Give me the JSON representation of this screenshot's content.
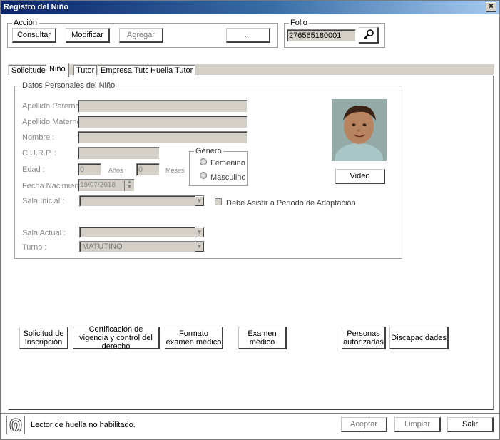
{
  "window": {
    "title": "Registro del Niño",
    "close_glyph": "×"
  },
  "accion": {
    "legend": "Acción",
    "buttons": {
      "consultar": "Consultar",
      "modificar": "Modificar",
      "agregar": "Agregar",
      "ellipsis": "..."
    }
  },
  "folio": {
    "legend": "Folio",
    "value": "276565180001",
    "search_icon": "key-search-icon"
  },
  "tabs": [
    "Solicitudes",
    "Niño",
    "Tutor",
    "Empresa Tutor",
    "Huella Tutor"
  ],
  "active_tab": "Niño",
  "datos": {
    "legend": "Datos Personales del Niño",
    "labels": {
      "apellido_paterno": "Apellido Paterno :",
      "apellido_materno": "Apellido Materno :",
      "nombre": "Nombre :",
      "curp": "C.U.R.P. :",
      "edad": "Edad :",
      "anos": "Años",
      "meses": "Meses",
      "fecha_nacimiento": "Fecha Nacimiento :",
      "sala_inicial": "Sala Inicial :",
      "sala_actual": "Sala Actual :",
      "turno": "Turno :"
    },
    "values": {
      "edad_anos": "0",
      "edad_meses": "0",
      "fecha_nacimiento": "18/07/2018",
      "turno": "MATUTINO"
    },
    "genero": {
      "legend": "Género",
      "options": [
        "Femenino",
        "Masculino"
      ]
    },
    "adaptacion_label": "Debe Asistir a Periodo de Adaptación",
    "video_button": "Video"
  },
  "doc_buttons": {
    "solicitud": "Solicitud de Inscripción",
    "certificacion": "Certificación de vigencia y control del derecho",
    "formato": "Formato examen médico",
    "examen": "Examen médico",
    "personas": "Personas autorizadas",
    "discapacidades": "Discapacidades"
  },
  "status": {
    "fingerprint_icon": "fingerprint-icon",
    "text": "Lector de huella no habilitado."
  },
  "footer": {
    "aceptar": "Aceptar",
    "limpiar": "Limpiar",
    "salir": "Salir"
  }
}
